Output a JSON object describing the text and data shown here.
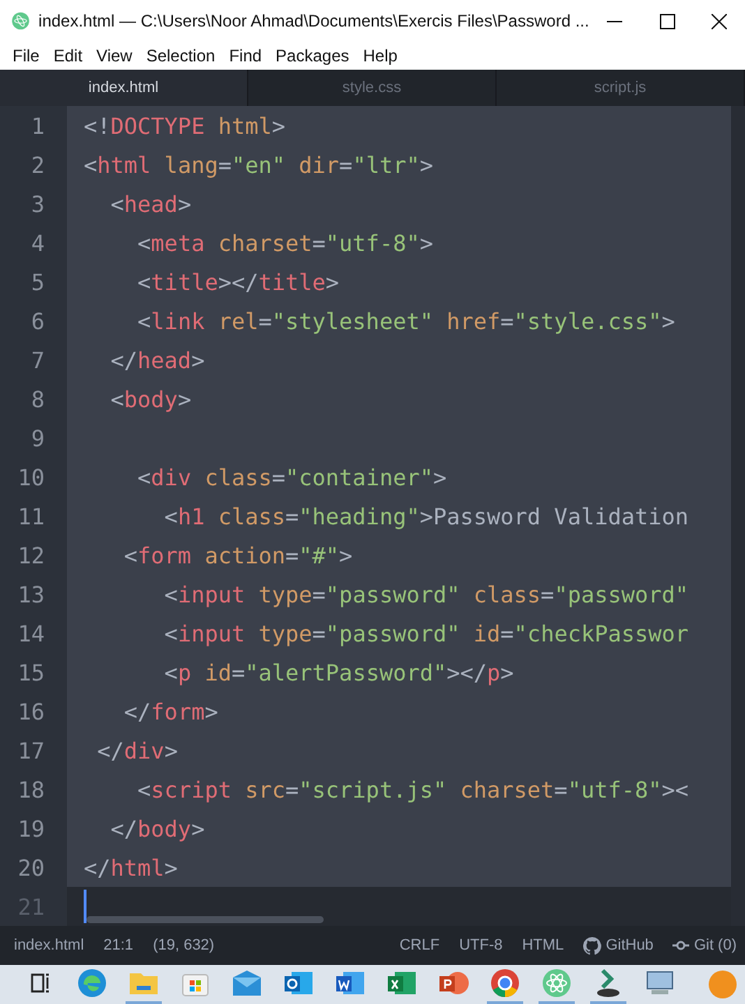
{
  "window": {
    "title": "index.html — C:\\Users\\Noor Ahmad\\Documents\\Exercis Files\\Password ..."
  },
  "menu": [
    "File",
    "Edit",
    "View",
    "Selection",
    "Find",
    "Packages",
    "Help"
  ],
  "tabs": [
    {
      "label": "index.html",
      "selected": true
    },
    {
      "label": "style.css",
      "selected": false
    },
    {
      "label": "script.js",
      "selected": false
    }
  ],
  "editor": {
    "lines": [
      {
        "number": "1",
        "selected": true,
        "tokens": [
          {
            "kind": "punct",
            "text": "<!"
          },
          {
            "kind": "tag",
            "text": "DOCTYPE"
          },
          {
            "kind": "attr",
            "text": " html"
          },
          {
            "kind": "punct",
            "text": ">"
          }
        ]
      },
      {
        "number": "2",
        "selected": true,
        "tokens": [
          {
            "kind": "punct",
            "text": "<"
          },
          {
            "kind": "tag",
            "text": "html"
          },
          {
            "kind": "attr",
            "text": " lang"
          },
          {
            "kind": "punct",
            "text": "="
          },
          {
            "kind": "str",
            "text": "\"en\""
          },
          {
            "kind": "attr",
            "text": " dir"
          },
          {
            "kind": "punct",
            "text": "="
          },
          {
            "kind": "str",
            "text": "\"ltr\""
          },
          {
            "kind": "punct",
            "text": ">"
          }
        ]
      },
      {
        "number": "3",
        "selected": true,
        "tokens": [
          {
            "kind": "punct",
            "text": "  <"
          },
          {
            "kind": "tag",
            "text": "head"
          },
          {
            "kind": "punct",
            "text": ">"
          }
        ]
      },
      {
        "number": "4",
        "selected": true,
        "tokens": [
          {
            "kind": "punct",
            "text": "    <"
          },
          {
            "kind": "tag",
            "text": "meta"
          },
          {
            "kind": "attr",
            "text": " charset"
          },
          {
            "kind": "punct",
            "text": "="
          },
          {
            "kind": "str",
            "text": "\"utf-8\""
          },
          {
            "kind": "punct",
            "text": ">"
          }
        ]
      },
      {
        "number": "5",
        "selected": true,
        "tokens": [
          {
            "kind": "punct",
            "text": "    <"
          },
          {
            "kind": "tag",
            "text": "title"
          },
          {
            "kind": "punct",
            "text": "></"
          },
          {
            "kind": "tag",
            "text": "title"
          },
          {
            "kind": "punct",
            "text": ">"
          }
        ]
      },
      {
        "number": "6",
        "selected": true,
        "tokens": [
          {
            "kind": "punct",
            "text": "    <"
          },
          {
            "kind": "tag",
            "text": "link"
          },
          {
            "kind": "attr",
            "text": " rel"
          },
          {
            "kind": "punct",
            "text": "="
          },
          {
            "kind": "str",
            "text": "\"stylesheet\""
          },
          {
            "kind": "attr",
            "text": " href"
          },
          {
            "kind": "punct",
            "text": "="
          },
          {
            "kind": "str",
            "text": "\"style.css\""
          },
          {
            "kind": "punct",
            "text": ">"
          }
        ]
      },
      {
        "number": "7",
        "selected": true,
        "tokens": [
          {
            "kind": "punct",
            "text": "  </"
          },
          {
            "kind": "tag",
            "text": "head"
          },
          {
            "kind": "punct",
            "text": ">"
          }
        ]
      },
      {
        "number": "8",
        "selected": true,
        "tokens": [
          {
            "kind": "punct",
            "text": "  <"
          },
          {
            "kind": "tag",
            "text": "body"
          },
          {
            "kind": "punct",
            "text": ">"
          }
        ]
      },
      {
        "number": "9",
        "selected": true
      },
      {
        "number": "10",
        "selected": true,
        "tokens": [
          {
            "kind": "punct",
            "text": "    <"
          },
          {
            "kind": "tag",
            "text": "div"
          },
          {
            "kind": "attr",
            "text": " class"
          },
          {
            "kind": "punct",
            "text": "="
          },
          {
            "kind": "str",
            "text": "\"container\""
          },
          {
            "kind": "punct",
            "text": ">"
          }
        ]
      },
      {
        "number": "11",
        "selected": true,
        "tokens": [
          {
            "kind": "punct",
            "text": "      <"
          },
          {
            "kind": "tag",
            "text": "h1"
          },
          {
            "kind": "attr",
            "text": " class"
          },
          {
            "kind": "punct",
            "text": "="
          },
          {
            "kind": "str",
            "text": "\"heading\""
          },
          {
            "kind": "punct",
            "text": ">"
          },
          {
            "kind": "text",
            "text": "Password Validation"
          }
        ]
      },
      {
        "number": "12",
        "selected": true,
        "tokens": [
          {
            "kind": "punct",
            "text": "   <"
          },
          {
            "kind": "tag",
            "text": "form"
          },
          {
            "kind": "attr",
            "text": " action"
          },
          {
            "kind": "punct",
            "text": "="
          },
          {
            "kind": "str",
            "text": "\"#\""
          },
          {
            "kind": "punct",
            "text": ">"
          }
        ]
      },
      {
        "number": "13",
        "selected": true,
        "tokens": [
          {
            "kind": "punct",
            "text": "      <"
          },
          {
            "kind": "tag",
            "text": "input"
          },
          {
            "kind": "attr",
            "text": " type"
          },
          {
            "kind": "punct",
            "text": "="
          },
          {
            "kind": "str",
            "text": "\"password\""
          },
          {
            "kind": "attr",
            "text": " class"
          },
          {
            "kind": "punct",
            "text": "="
          },
          {
            "kind": "str",
            "text": "\"password\""
          }
        ]
      },
      {
        "number": "14",
        "selected": true,
        "tokens": [
          {
            "kind": "punct",
            "text": "      <"
          },
          {
            "kind": "tag",
            "text": "input"
          },
          {
            "kind": "attr",
            "text": " type"
          },
          {
            "kind": "punct",
            "text": "="
          },
          {
            "kind": "str",
            "text": "\"password\""
          },
          {
            "kind": "attr",
            "text": " id"
          },
          {
            "kind": "punct",
            "text": "="
          },
          {
            "kind": "str",
            "text": "\"checkPasswor"
          }
        ]
      },
      {
        "number": "15",
        "selected": true,
        "tokens": [
          {
            "kind": "punct",
            "text": "      <"
          },
          {
            "kind": "tag",
            "text": "p"
          },
          {
            "kind": "attr",
            "text": " id"
          },
          {
            "kind": "punct",
            "text": "="
          },
          {
            "kind": "str",
            "text": "\"alertPassword\""
          },
          {
            "kind": "punct",
            "text": "></"
          },
          {
            "kind": "tag",
            "text": "p"
          },
          {
            "kind": "punct",
            "text": ">"
          }
        ]
      },
      {
        "number": "16",
        "selected": true,
        "tokens": [
          {
            "kind": "punct",
            "text": "   </"
          },
          {
            "kind": "tag",
            "text": "form"
          },
          {
            "kind": "punct",
            "text": ">"
          }
        ]
      },
      {
        "number": "17",
        "selected": true,
        "tokens": [
          {
            "kind": "punct",
            "text": " </"
          },
          {
            "kind": "tag",
            "text": "div"
          },
          {
            "kind": "punct",
            "text": ">"
          }
        ]
      },
      {
        "number": "18",
        "selected": true,
        "tokens": [
          {
            "kind": "punct",
            "text": "    <"
          },
          {
            "kind": "tag",
            "text": "script"
          },
          {
            "kind": "attr",
            "text": " src"
          },
          {
            "kind": "punct",
            "text": "="
          },
          {
            "kind": "str",
            "text": "\"script.js\""
          },
          {
            "kind": "attr",
            "text": " charset"
          },
          {
            "kind": "punct",
            "text": "="
          },
          {
            "kind": "str",
            "text": "\"utf-8\""
          },
          {
            "kind": "punct",
            "text": "><"
          }
        ]
      },
      {
        "number": "19",
        "selected": true,
        "tokens": [
          {
            "kind": "punct",
            "text": "  </"
          },
          {
            "kind": "tag",
            "text": "body"
          },
          {
            "kind": "punct",
            "text": ">"
          }
        ]
      },
      {
        "number": "20",
        "selected": true,
        "tokens": [
          {
            "kind": "punct",
            "text": "</"
          },
          {
            "kind": "tag",
            "text": "html"
          },
          {
            "kind": "punct",
            "text": ">"
          }
        ]
      },
      {
        "number": "21",
        "selected": false
      }
    ]
  },
  "status_bar": {
    "left": [
      "index.html",
      "21:1",
      "(19, 632)"
    ],
    "right": [
      "CRLF",
      "UTF-8",
      "HTML"
    ],
    "github": "GitHub",
    "git": "Git (0)"
  },
  "taskbar": [
    {
      "kind": "taskview",
      "active": false
    },
    {
      "kind": "browser",
      "active": false
    },
    {
      "kind": "folder",
      "active": true
    },
    {
      "kind": "store",
      "active": false
    },
    {
      "kind": "mail",
      "active": false
    },
    {
      "kind": "outlook",
      "active": false
    },
    {
      "kind": "word",
      "active": false
    },
    {
      "kind": "excel",
      "active": false
    },
    {
      "kind": "slides",
      "active": false
    },
    {
      "kind": "chrome",
      "active": true
    },
    {
      "kind": "atom",
      "active": true
    },
    {
      "kind": "tool",
      "active": true
    },
    {
      "kind": "monitor",
      "active": false
    }
  ]
}
